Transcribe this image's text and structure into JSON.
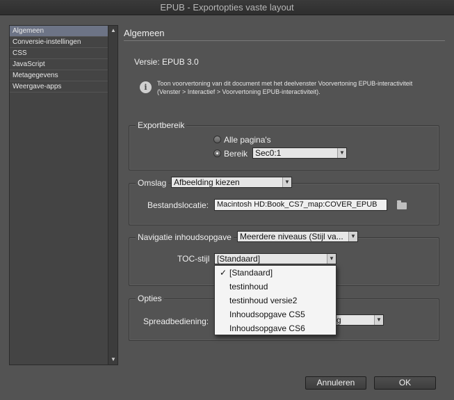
{
  "window": {
    "title": "EPUB - Exportopties vaste layout"
  },
  "sidebar": {
    "items": [
      {
        "label": "Algemeen",
        "active": true
      },
      {
        "label": "Conversie-instellingen"
      },
      {
        "label": "CSS"
      },
      {
        "label": "JavaScript"
      },
      {
        "label": "Metagegevens"
      },
      {
        "label": "Weergave-apps"
      }
    ]
  },
  "main": {
    "section_title": "Algemeen",
    "version_label": "Versie: EPUB 3.0",
    "info_line1": "Toon voorvertoning van dit document met het deelvenster Voorvertoning EPUB-interactiviteit",
    "info_line2": "(Venster > Interactief > Voorvertoning EPUB-interactiviteit)."
  },
  "export_range": {
    "legend": "Exportbereik",
    "all_pages_label": "Alle pagina's",
    "range_label": "Bereik",
    "range_value": "Sec0:1",
    "selected": "range"
  },
  "cover": {
    "legend": "Omslag",
    "select_value": "Afbeelding kiezen",
    "file_location_label": "Bestandslocatie:",
    "file_location_value": "Macintosh HD:Book_CS7_map:COVER_EPUB"
  },
  "toc": {
    "legend": "Navigatie inhoudsopgave",
    "select_value": "Meerdere niveaus (Stijl va...",
    "style_label": "TOC-stijl",
    "style_value": "[Standaard]",
    "options": [
      {
        "label": "[Standaard]",
        "checked": true
      },
      {
        "label": "testinhoud"
      },
      {
        "label": "testinhoud versie2"
      },
      {
        "label": "Inhoudsopgave CS5"
      },
      {
        "label": "Inhoudsopgave CS6"
      }
    ]
  },
  "options": {
    "legend": "Opties",
    "spread_label": "Spreadbediening:",
    "spread_value_partial": "g"
  },
  "buttons": {
    "cancel": "Annuleren",
    "ok": "OK"
  },
  "colors": {
    "background": "#535353",
    "selection": "#6d7486"
  }
}
